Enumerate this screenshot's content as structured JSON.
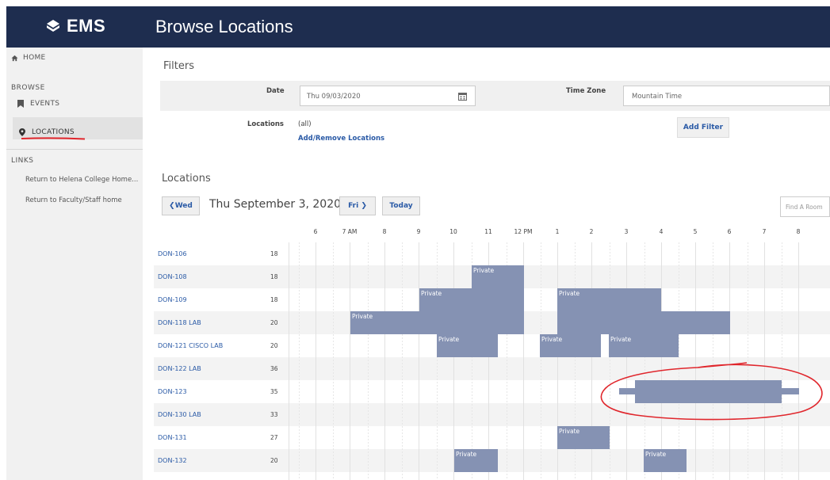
{
  "app": {
    "logo_text": "EMS",
    "page_title": "Browse Locations"
  },
  "colors": {
    "topbar": "#1e2d4f",
    "link": "#2a5aa6",
    "booking": "#8592b3",
    "annotation": "#e0262c"
  },
  "sidebar": {
    "home": "HOME",
    "browse_section": "BROWSE",
    "events": "EVENTS",
    "locations": "LOCATIONS",
    "links_section": "LINKS",
    "links": [
      "Return to Helena College Home...",
      "Return to Faculty/Staff home"
    ]
  },
  "filters": {
    "title": "Filters",
    "date_label": "Date",
    "date_value": "Thu 09/03/2020",
    "timezone_label": "Time Zone",
    "timezone_value": "Mountain Time",
    "locations_label": "Locations",
    "locations_value": "(all)",
    "add_remove_link": "Add/Remove Locations",
    "add_filter_button": "Add Filter"
  },
  "locations": {
    "title": "Locations",
    "prev_button": "Wed",
    "current_date": "Thu September 3, 2020",
    "next_button": "Fri",
    "today_button": "Today",
    "find_placeholder": "Find A Room",
    "hours": [
      "6",
      "7 AM",
      "8",
      "9",
      "10",
      "11",
      "12 PM",
      "1",
      "2",
      "3",
      "4",
      "5",
      "6",
      "7",
      "8"
    ],
    "rooms": [
      {
        "name": "DON-106",
        "capacity": "18"
      },
      {
        "name": "DON-108",
        "capacity": "18"
      },
      {
        "name": "DON-109",
        "capacity": "18"
      },
      {
        "name": "DON-118 LAB",
        "capacity": "20"
      },
      {
        "name": "DON-121 CISCO LAB",
        "capacity": "20"
      },
      {
        "name": "DON-122 LAB",
        "capacity": "36"
      },
      {
        "name": "DON-123",
        "capacity": "35"
      },
      {
        "name": "DON-130 LAB",
        "capacity": "33"
      },
      {
        "name": "DON-131",
        "capacity": "27"
      },
      {
        "name": "DON-132",
        "capacity": "20"
      }
    ],
    "booking_label": "Private"
  }
}
